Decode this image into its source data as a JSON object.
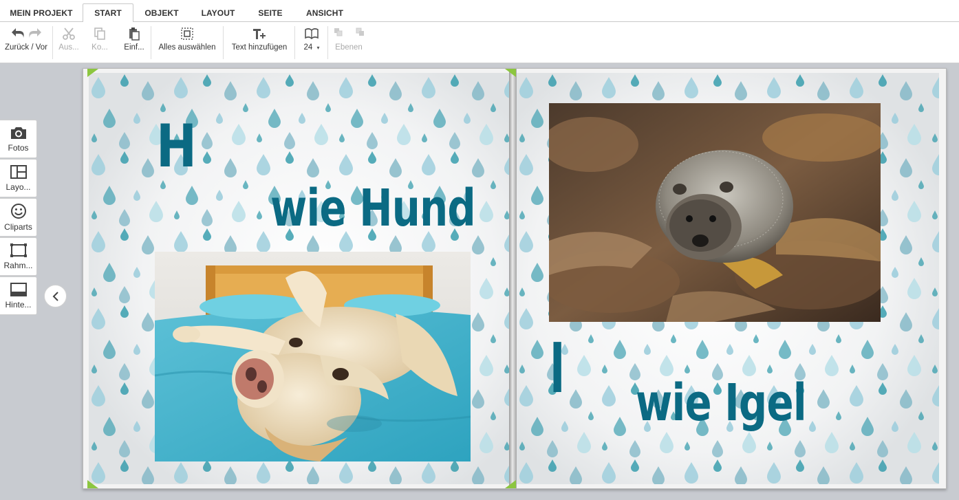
{
  "tabs": [
    {
      "label": "MEIN PROJEKT"
    },
    {
      "label": "START"
    },
    {
      "label": "OBJEKT"
    },
    {
      "label": "LAYOUT"
    },
    {
      "label": "SEITE"
    },
    {
      "label": "ANSICHT"
    }
  ],
  "ribbon": {
    "undo_redo_label": "Zurück / Vor",
    "cut_label": "Aus...",
    "copy_label": "Ko...",
    "paste_label": "Einf...",
    "select_all_label": "Alles auswählen",
    "add_text_label": "Text hinzufügen",
    "page_count": "24",
    "layers_label": "Ebenen"
  },
  "sidebar": {
    "items": [
      {
        "label": "Fotos"
      },
      {
        "label": "Layo..."
      },
      {
        "label": "Cliparts"
      },
      {
        "label": "Rahm..."
      },
      {
        "label": "Hinte..."
      }
    ]
  },
  "book": {
    "left_page": {
      "letter": "H",
      "title": "wie Hund"
    },
    "right_page": {
      "letter": "I",
      "title": "wie Igel"
    }
  },
  "colors": {
    "text_accent": "#0b6a83",
    "drop_light": "#9fcfdd",
    "drop_dark": "#2e9aaa",
    "corner_marker": "#8cc63f"
  }
}
